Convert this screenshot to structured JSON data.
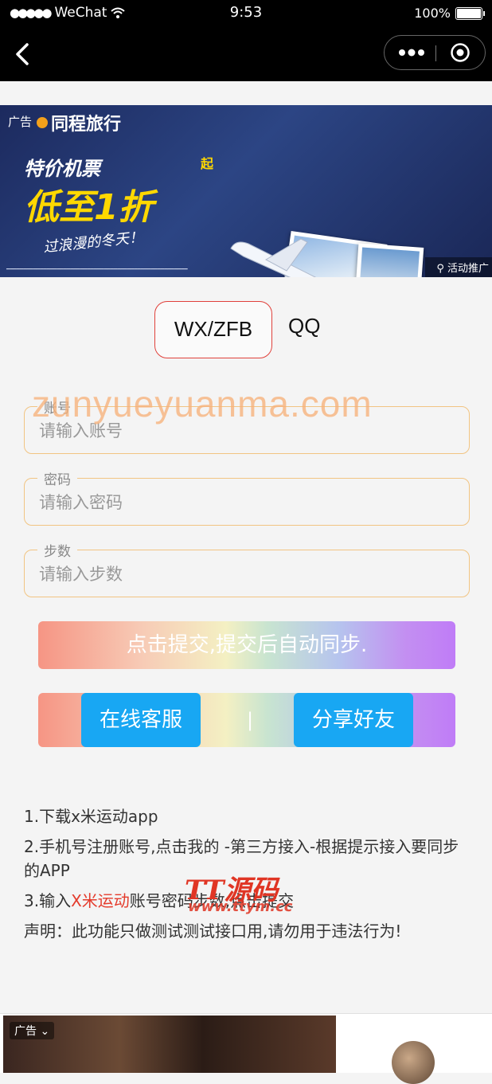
{
  "status_bar": {
    "carrier": "WeChat",
    "time": "9:53",
    "battery": "100%"
  },
  "nav": {
    "back_icon": "chevron-left-icon",
    "more_icon": "more-dots-icon",
    "close_icon": "target-close-icon"
  },
  "banner": {
    "ad_label": "广告",
    "brand": "同程旅行",
    "headline_1": "特价机票",
    "headline_2": "低至1折",
    "headline_sup": "起",
    "tagline": "过浪漫的冬天！",
    "activity_label": "活动推广"
  },
  "tabs": [
    {
      "label": "WX/ZFB",
      "selected": true
    },
    {
      "label": "QQ",
      "selected": false
    }
  ],
  "watermark": "zunyueyuanma.com",
  "form": {
    "account": {
      "label": "账号",
      "placeholder": "请输入账号",
      "value": ""
    },
    "password": {
      "label": "密码",
      "placeholder": "请输入密码",
      "value": ""
    },
    "steps": {
      "label": "步数",
      "placeholder": "请输入步数",
      "value": ""
    }
  },
  "submit_label": "点击提交,提交后自动同步.",
  "actions": {
    "service_label": "在线客服",
    "separator": "|",
    "share_label": "分享好友"
  },
  "instructions": {
    "step1": "1.下载x米运动app",
    "step2": "2.手机号注册账号,点击我的 -第三方接入-根据提示接入要同步的APP",
    "step3_prefix": "3.输入",
    "step3_highlight": "X米运动",
    "step3_suffix": "账号密码步数,点击提交",
    "disclaimer": "声明：此功能只做测试测试接口用,请勿用于违法行为!"
  },
  "overlay_logo": {
    "name": "TT源码",
    "url": "www.ttym.cc"
  },
  "bottom_ad": {
    "ad_label": "广告"
  },
  "colors": {
    "accent_blue": "#18a7f3",
    "tab_border": "#e0413b",
    "field_border": "#f1c482",
    "highlight_red": "#e43b2c"
  }
}
